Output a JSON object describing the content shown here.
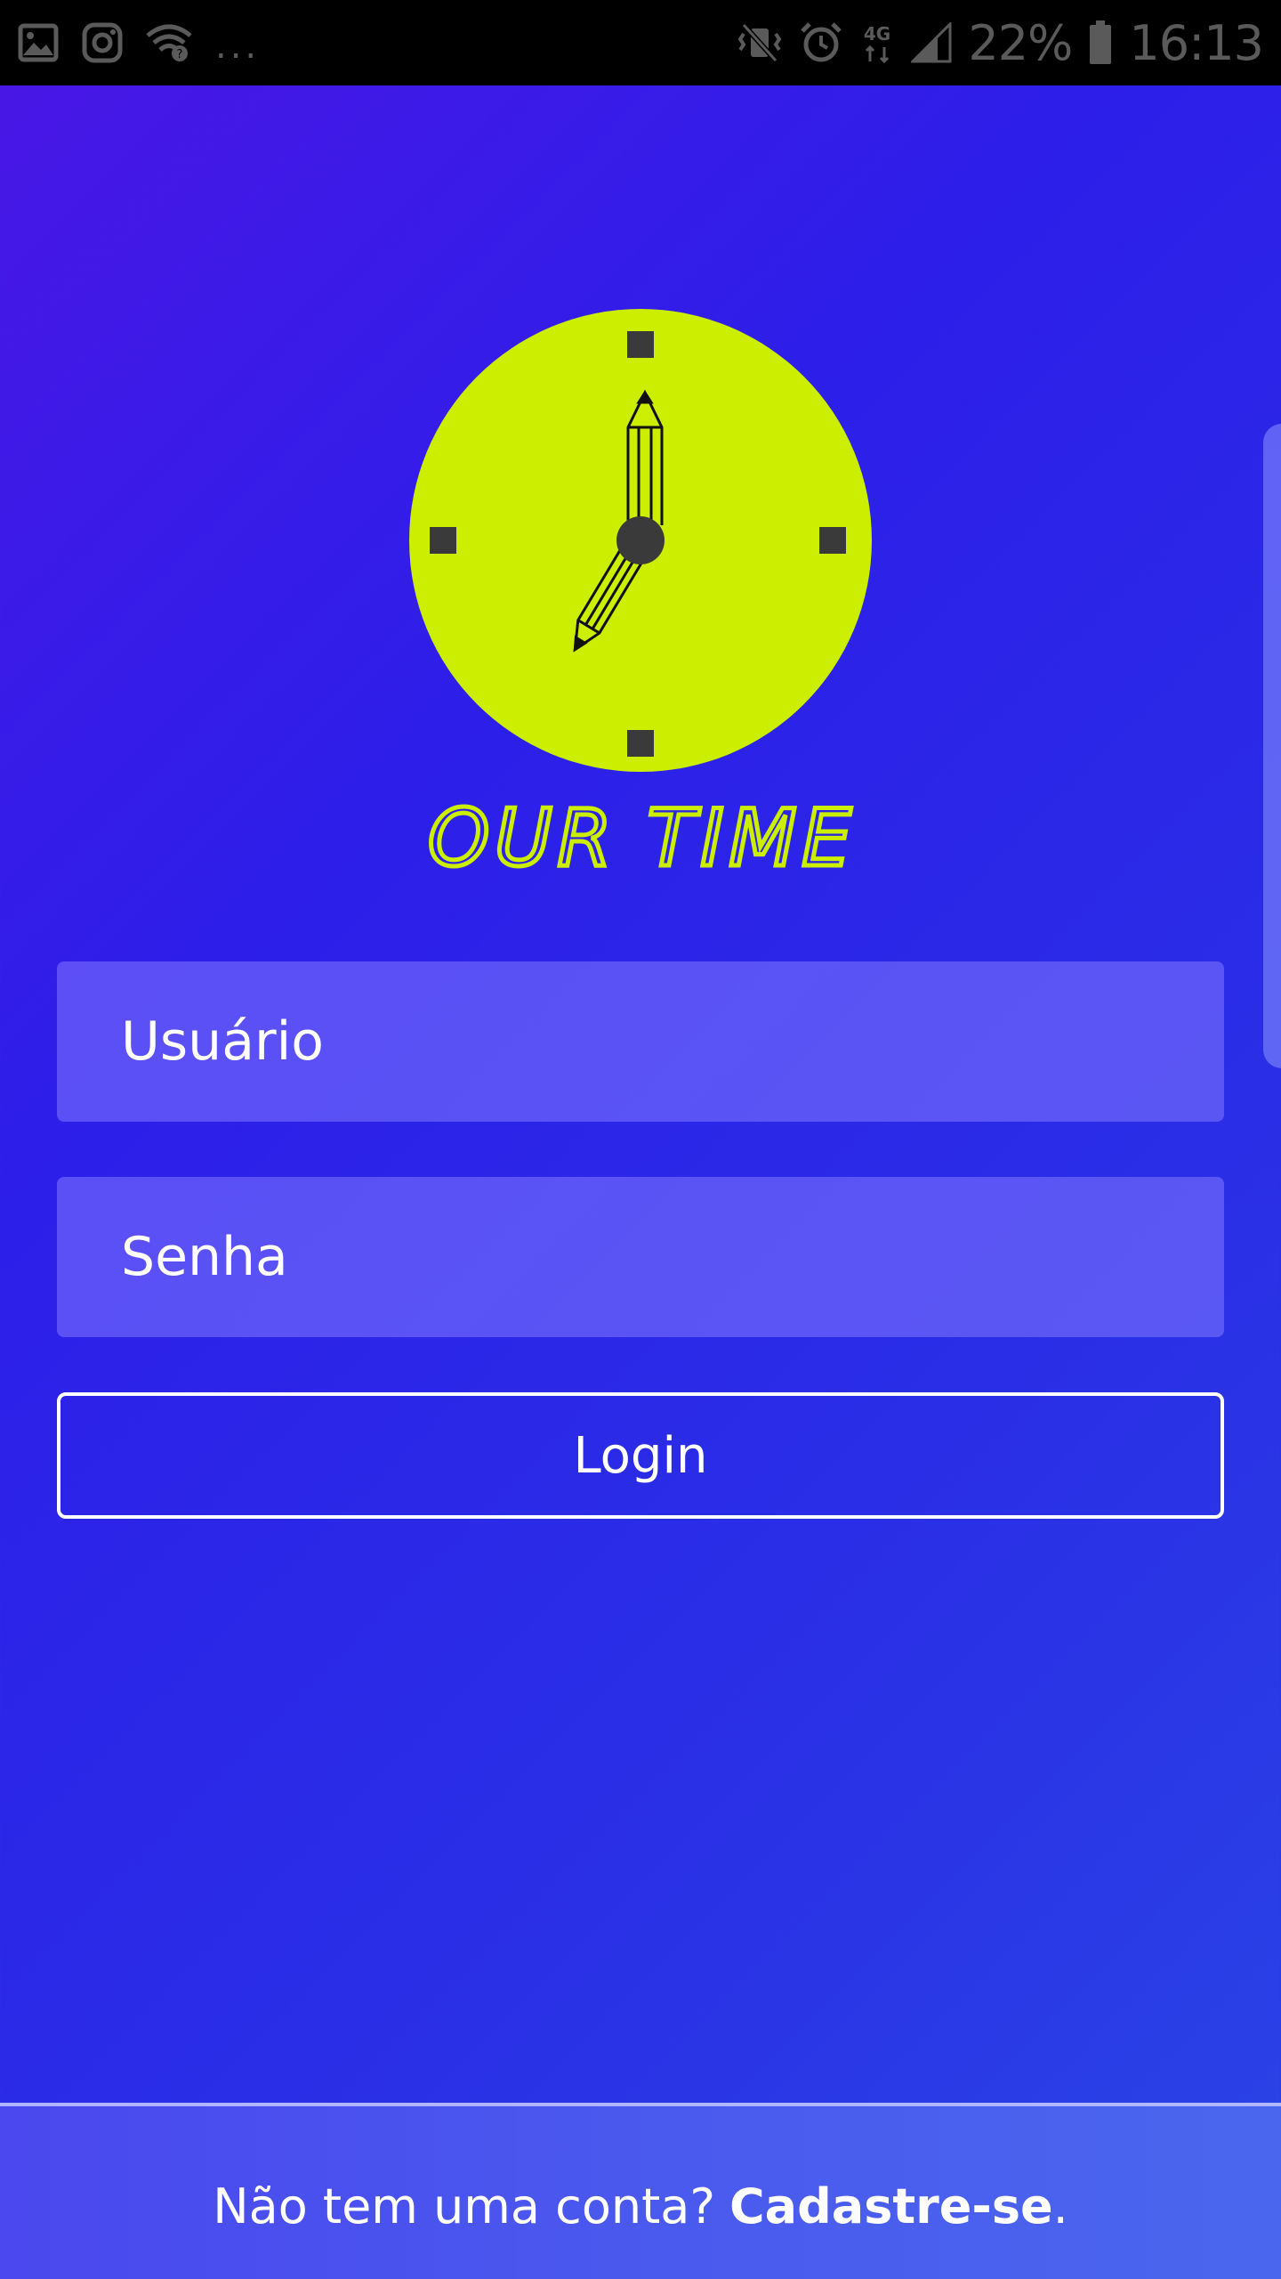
{
  "status_bar": {
    "notification_icons": [
      "image-icon",
      "instagram-icon",
      "wifi-question-icon"
    ],
    "more_indicator": "...",
    "system_icons": [
      "vibrate-icon",
      "alarm-icon",
      "network-4g-icon",
      "signal-icon",
      "battery-icon"
    ],
    "network_label": "4G",
    "battery_percent": "22%",
    "time": "16:13"
  },
  "logo": {
    "text": "OUR TIME",
    "clock_color": "#ccee00",
    "marker_color": "#3a3a3a"
  },
  "form": {
    "username_placeholder": "Usuário",
    "password_placeholder": "Senha",
    "login_label": "Login"
  },
  "footer": {
    "prompt": "Não tem uma conta?",
    "signup_link": "Cadastre-se",
    "trailing": "."
  },
  "colors": {
    "background_start": "#4a16e6",
    "background_end": "#2a45e6",
    "field_background": "#7a78ff",
    "accent": "#ccee00"
  }
}
